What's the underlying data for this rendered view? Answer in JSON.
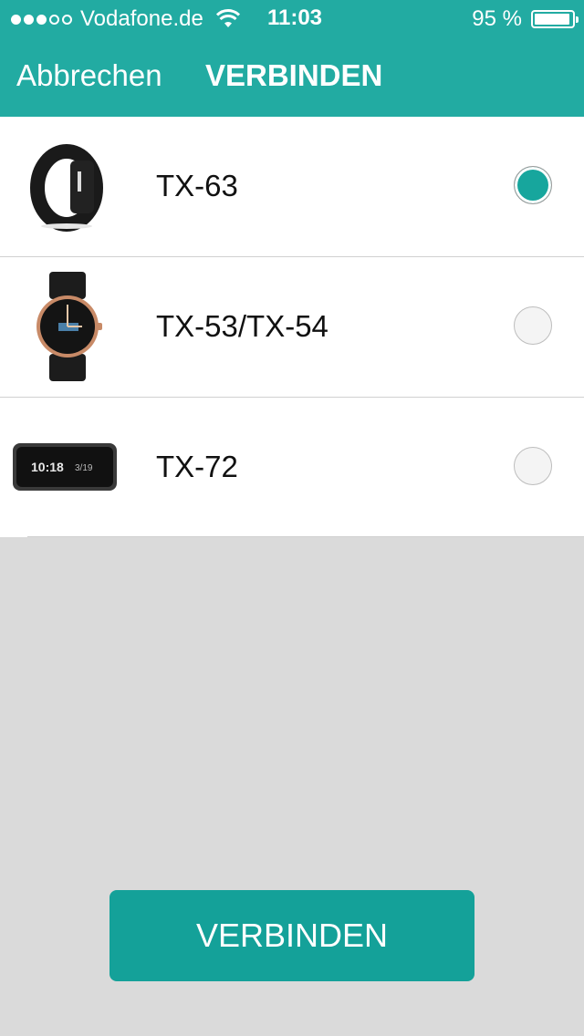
{
  "status_bar": {
    "carrier": "Vodafone.de",
    "time": "11:03",
    "battery": "95 %",
    "signal_bars_filled": 3,
    "signal_bars_total": 5,
    "battery_level": 0.95
  },
  "nav": {
    "cancel_label": "Abbrechen",
    "title": "VERBINDEN"
  },
  "devices": [
    {
      "name": "TX-63",
      "selected": true,
      "icon": "fitness-band-icon"
    },
    {
      "name": "TX-53/TX-54",
      "selected": false,
      "icon": "wristwatch-icon"
    },
    {
      "name": "TX-72",
      "selected": false,
      "icon": "display-band-icon",
      "screen_time": "10:18",
      "screen_date": "3/19"
    }
  ],
  "connect_button": {
    "label": "VERBINDEN"
  },
  "colors": {
    "header": "#22aba2",
    "accent": "#14a199",
    "background": "#dadada"
  }
}
